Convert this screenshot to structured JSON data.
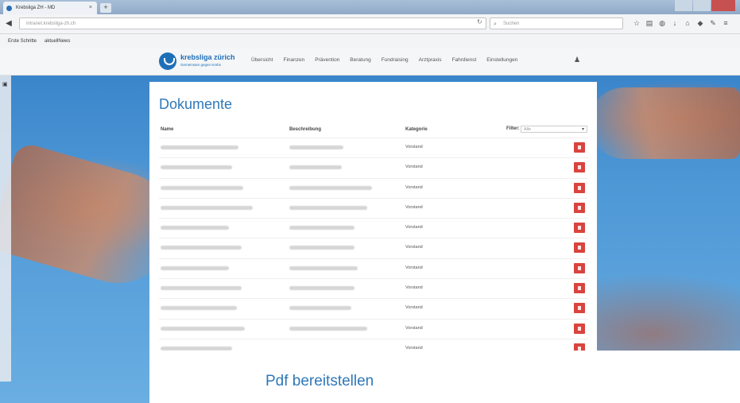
{
  "browser": {
    "tab_title": "Krebsliga ZH - MD",
    "tab_close": "×",
    "new_tab": "+",
    "url": "intranet.krebsliga-zh.ch",
    "search_placeholder": "Suchen",
    "bookmarks": [
      "Erste Schritte",
      "aktuellNews"
    ]
  },
  "site": {
    "logo_title": "krebsliga zürich",
    "logo_sub": "Gemeinsam gegen Krebs",
    "nav": [
      "Übersicht",
      "Finanzen",
      "Prävention",
      "Beratung",
      "Fundraising",
      "Arztpraxis",
      "Fahrdienst",
      "Einstellungen"
    ]
  },
  "documents": {
    "title": "Dokumente",
    "headers": {
      "name": "Name",
      "beschreibung": "Beschreibung",
      "kategorie": "Kategorie"
    },
    "filter_label": "Filter:",
    "filter_value": "Alle",
    "rows": [
      {
        "kategorie": "Vorstand"
      },
      {
        "kategorie": "Vorstand"
      },
      {
        "kategorie": "Vorstand"
      },
      {
        "kategorie": "Vorstand"
      },
      {
        "kategorie": "Vorstand"
      },
      {
        "kategorie": "Vorstand"
      },
      {
        "kategorie": "Vorstand"
      },
      {
        "kategorie": "Vorstand"
      },
      {
        "kategorie": "Vorstand"
      },
      {
        "kategorie": "Vorstand"
      },
      {
        "kategorie": "Vorstand"
      },
      {
        "kategorie": ""
      },
      {
        "kategorie": ""
      }
    ]
  },
  "pdf": {
    "title": "Pdf bereitstellen"
  },
  "colors": {
    "accent": "#2f78b8",
    "delete": "#d9443e"
  }
}
